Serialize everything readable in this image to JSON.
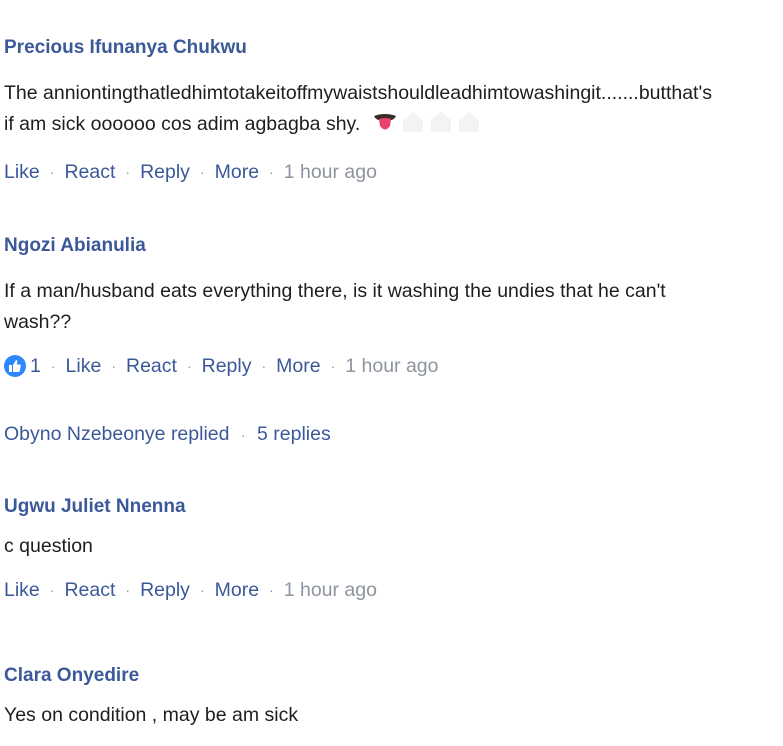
{
  "comments": [
    {
      "author": "Precious Ifunanya Chukwu",
      "text_line1": "The anniontingthatledhimtotakeitoffmywaistshouldleadhimtowashingit.......butthat's",
      "text_line2": "if am sick oooooo cos adim agbagba shy.",
      "emoji": [
        "tongue-emoji",
        "blank-emoji",
        "blank-emoji",
        "blank-emoji"
      ],
      "actions": {
        "like": "Like",
        "react": "React",
        "reply": "Reply",
        "more": "More",
        "time": "1 hour ago"
      }
    },
    {
      "author": "Ngozi Abianulia",
      "text_line1": "If a man/husband eats everything there, is it washing the undies that he can't",
      "text_line2": "wash??",
      "like_count": "1",
      "actions": {
        "like": "Like",
        "react": "React",
        "reply": "Reply",
        "more": "More",
        "time": "1 hour ago"
      },
      "replies": {
        "who": "Obyno Nzebeonye replied",
        "count": "5 replies"
      }
    },
    {
      "author": "Ugwu Juliet Nnenna",
      "text_line1": "c question",
      "actions": {
        "like": "Like",
        "react": "React",
        "reply": "Reply",
        "more": "More",
        "time": "1 hour ago"
      }
    },
    {
      "author": "Clara Onyedire",
      "text_line1": "Yes on condition , may be am sick"
    }
  ],
  "colors": {
    "link": "#3b5998",
    "meta": "#8d949e",
    "text": "#1c1e21",
    "like_badge": "#2d88ff"
  }
}
